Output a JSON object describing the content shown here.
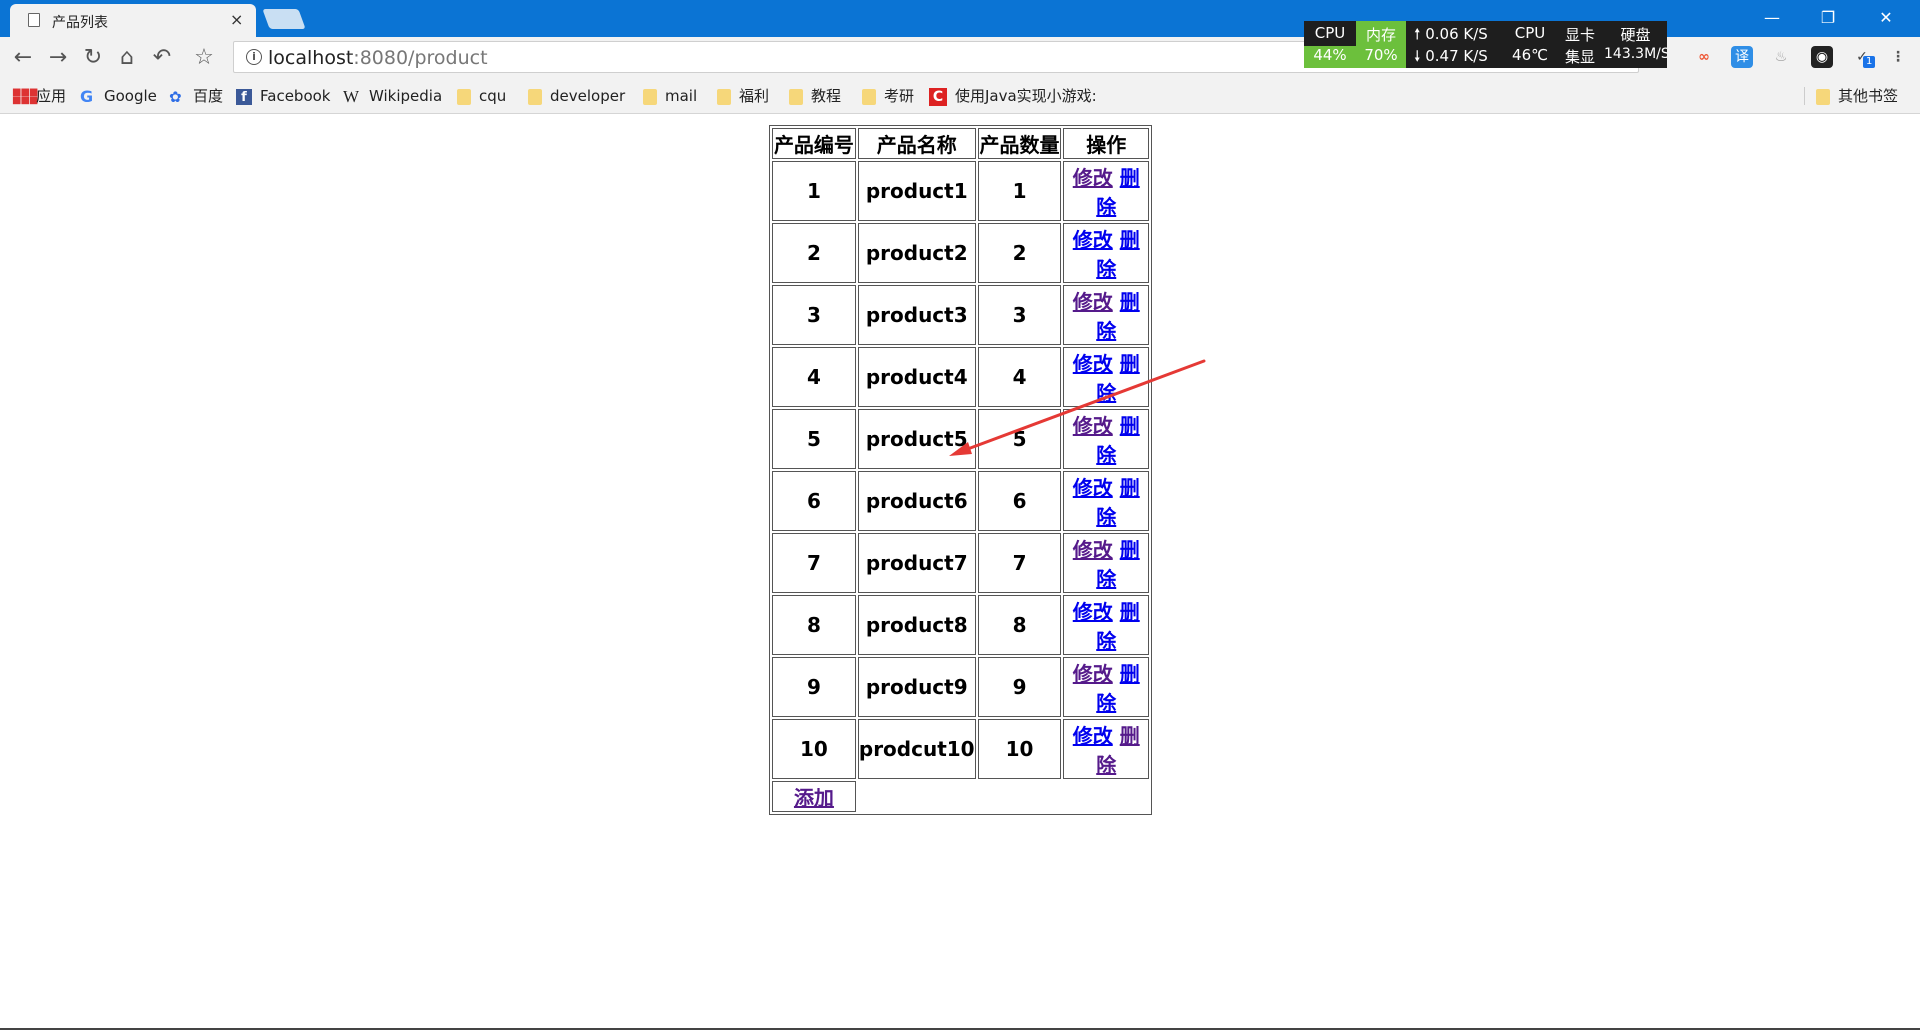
{
  "window": {
    "tab_title": "产品列表",
    "tab_close": "×",
    "min": "—",
    "restore": "❐",
    "close": "✕"
  },
  "toolbar": {
    "url_host": "localhost",
    "url_rest": ":8080/product"
  },
  "monitor": {
    "cpu_label": "CPU",
    "cpu_value": "44%",
    "mem_label": "内存",
    "mem_value": "70%",
    "up": "0.06 K/S",
    "down": "0.47 K/S",
    "cpu_temp_label": "CPU",
    "cpu_temp": "46℃",
    "gpu_label": "显卡",
    "gpu_value": "集显",
    "disk_label": "硬盘",
    "disk_value": "143.3M/S"
  },
  "extensions": {
    "translate": "译",
    "badge": "1"
  },
  "bookmarks": {
    "apps": "应用",
    "google": "Google",
    "baidu": "百度",
    "facebook": "Facebook",
    "wikipedia": "Wikipedia",
    "cqu": "cqu",
    "developer": "developer",
    "mail": "mail",
    "fuli": "福利",
    "jiaocheng": "教程",
    "kaoyan": "考研",
    "java_game": "使用Java实现小游戏:",
    "other": "其他书签"
  },
  "table": {
    "headers": [
      "产品编号",
      "产品名称",
      "产品数量",
      "操作"
    ],
    "edit_label": "修改",
    "delete_label": "删除",
    "add_label": "添加",
    "rows": [
      {
        "id": "1",
        "name": "product1",
        "qty": "1"
      },
      {
        "id": "2",
        "name": "product2",
        "qty": "2"
      },
      {
        "id": "3",
        "name": "product3",
        "qty": "3"
      },
      {
        "id": "4",
        "name": "product4",
        "qty": "4"
      },
      {
        "id": "5",
        "name": "product5",
        "qty": "5"
      },
      {
        "id": "6",
        "name": "product6",
        "qty": "6"
      },
      {
        "id": "7",
        "name": "product7",
        "qty": "7"
      },
      {
        "id": "8",
        "name": "product8",
        "qty": "8"
      },
      {
        "id": "9",
        "name": "product9",
        "qty": "9"
      },
      {
        "id": "10",
        "name": "prodcut10",
        "qty": "10"
      }
    ]
  },
  "colors": {
    "titlebar": "#0b74d4",
    "link": "#0000ee",
    "visited": "#551a8b",
    "arrow": "#e53935"
  }
}
